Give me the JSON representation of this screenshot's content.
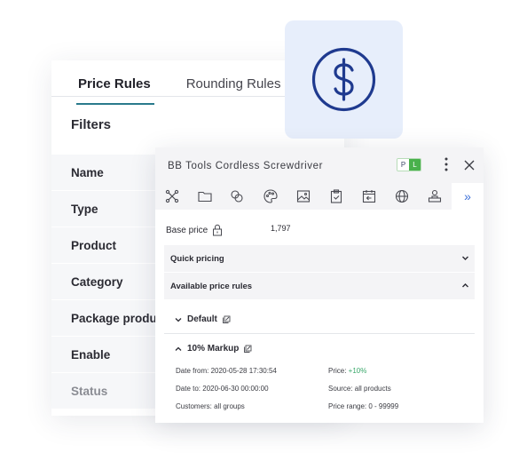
{
  "back_panel": {
    "tabs": [
      {
        "label": "Price Rules",
        "active": true
      },
      {
        "label": "Rounding Rules",
        "active": false
      }
    ],
    "filters_title": "Filters",
    "filters": [
      "Name",
      "Type",
      "Product",
      "Category",
      "Package produc",
      "Enable",
      "Status"
    ]
  },
  "dollar_card": {
    "icon": "dollar-circle-icon",
    "color": "#1f3a8f"
  },
  "product_window": {
    "title": "BB Tools Cordless Screwdriver",
    "lang_badges": [
      "P",
      "L"
    ],
    "toolbar_icons": [
      "nodes-icon",
      "folder-icon",
      "link-icon",
      "palette-icon",
      "image-icon",
      "clipboard-check-icon",
      "calendar-back-icon",
      "globe-icon",
      "user-stand-icon"
    ],
    "more_label": "»",
    "base_price_label": "Base price",
    "base_price_value": "1,797",
    "sections": [
      {
        "label": "Quick pricing",
        "expanded": false
      },
      {
        "label": "Available price rules",
        "expanded": true
      }
    ],
    "rules": [
      {
        "label": "Default",
        "expanded": false
      },
      {
        "label": "10% Markup",
        "expanded": true
      }
    ],
    "details": {
      "date_from": "Date from: 2020-05-28 17:30:54",
      "date_to": "Date to: 2020-06-30 00:00:00",
      "customers": "Customers: all groups",
      "price_label": "Price: ",
      "price_value": "+10%",
      "source": "Source: all products",
      "price_range": "Price range: 0 - 99999"
    }
  }
}
